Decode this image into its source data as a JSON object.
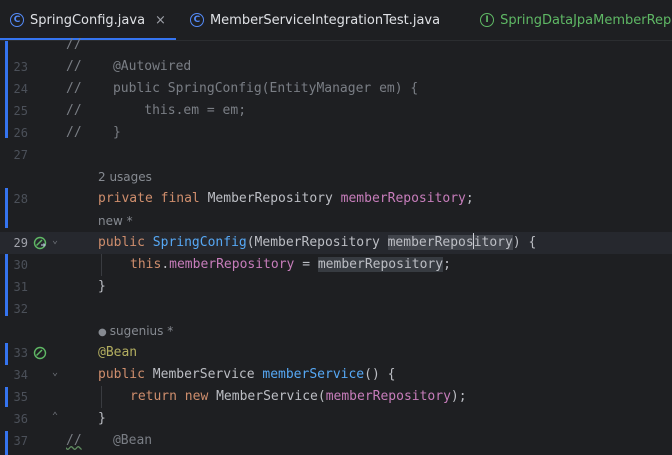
{
  "tabs": [
    {
      "label": "SpringConfig.java",
      "icon": "C",
      "close": "×"
    },
    {
      "label": "MemberServiceIntegrationTest.java",
      "icon": "C"
    },
    {
      "label": "SpringDataJpaMemberReposi",
      "icon": "I"
    }
  ],
  "editor": {
    "line_numbers": [
      "23",
      "24",
      "25",
      "26",
      "27",
      "28",
      "29",
      "30",
      "31",
      "32",
      "33",
      "34",
      "35",
      "36",
      "37"
    ],
    "hints": {
      "usages": "2 usages",
      "new": "new *",
      "author": "sugenius *"
    },
    "code": {
      "c_top": "//",
      "c23_slash": "//",
      "c23_rest": "    @Autowired",
      "c24_slash": "//",
      "c24_rest": "    public SpringConfig(EntityManager em) {",
      "c25_slash": "//",
      "c25_rest": "        this.em = em;",
      "c26_slash": "//",
      "c26_rest": "    }",
      "l28_private": "private",
      "l28_final": "final",
      "l28_type": "MemberRepository",
      "l28_field": "memberRepository",
      "l28_semi": ";",
      "l29_public": "public",
      "l29_name": "SpringConfig",
      "l29_paren": "(MemberRepository ",
      "l29_param_a": "memberRepos",
      "l29_param_b": "itory",
      "l29_end": ") {",
      "l30_this": "this",
      "l30_dot": ".",
      "l30_field": "memberRepository",
      "l30_eq": " = ",
      "l30_val": "memberRepository",
      "l30_semi": ";",
      "l31": "}",
      "l33_ann": "@Bean",
      "l34_public": "public",
      "l34_type": "MemberService",
      "l34_fn": "memberService",
      "l34_rest": "() {",
      "l35_return": "return",
      "l35_new": "new",
      "l35_ctor": "MemberService(",
      "l35_field": "memberRepository",
      "l35_end": ");",
      "l36": "}",
      "l37_slash": "//",
      "l37_rest": "    @Bean"
    }
  },
  "colors": {
    "accent": "#3574f0",
    "keyword": "#cf8e6d",
    "function": "#56a8f5",
    "field": "#c77dbb",
    "annotation": "#b3ae60",
    "comment": "#7a7e85",
    "gutter_icon": "#5fb865"
  },
  "icons": [
    "class-icon",
    "interface-icon",
    "close-icon",
    "bean-gutter-icon",
    "fold-icon",
    "user-icon"
  ]
}
